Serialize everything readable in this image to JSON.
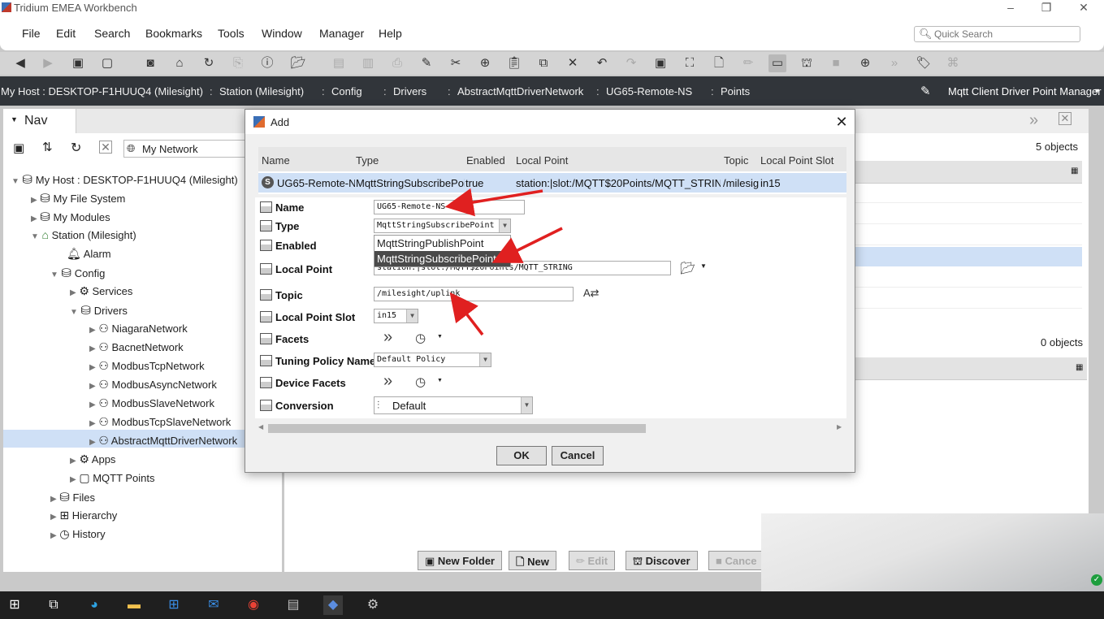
{
  "window": {
    "title": "Tridium EMEA Workbench"
  },
  "menu": [
    "File",
    "Edit",
    "Search",
    "Bookmarks",
    "Tools",
    "Window",
    "Manager",
    "Help"
  ],
  "quick_search": {
    "placeholder": "Quick Search"
  },
  "breadcrumb": [
    "My Host : DESKTOP-F1HUUQ4 (Milesight)",
    "Station (Milesight)",
    "Config",
    "Drivers",
    "AbstractMqttDriverNetwork",
    "UG65-Remote-NS",
    "Points"
  ],
  "view_selector": "Mqtt Client Driver Point Manager",
  "nav": {
    "tab_label": "Nav",
    "network_selector": "My Network",
    "tree": [
      "My Host : DESKTOP-F1HUUQ4 (Milesight)",
      "My File System",
      "My Modules",
      "Station (Milesight)",
      "Alarm",
      "Config",
      "Services",
      "Drivers",
      "NiagaraNetwork",
      "BacnetNetwork",
      "ModbusTcpNetwork",
      "ModbusAsyncNetwork",
      "ModbusSlaveNetwork",
      "ModbusTcpSlaveNetwork",
      "AbstractMqttDriverNetwork",
      "Apps",
      "MQTT Points",
      "Files",
      "Hierarchy",
      "History"
    ]
  },
  "main": {
    "objects_top": "5 objects",
    "objects_bottom": "0 objects",
    "buttons": [
      "New Folder",
      "New",
      "Edit",
      "Discover",
      "Cance"
    ]
  },
  "dialog": {
    "title": "Add",
    "columns": [
      "Name",
      "Type",
      "Enabled",
      "Local Point",
      "Topic",
      "Local Point Slot"
    ],
    "row": {
      "name": "UG65-Remote-N",
      "type": "MqttStringSubscribePoint",
      "enabled": "true",
      "local_point": "station:|slot:/MQTT$20Points/MQTT_STRING",
      "topic": "/milesig",
      "slot": "in15"
    },
    "fields": {
      "name_label": "Name",
      "name_value": "UG65-Remote-NS",
      "type_label": "Type",
      "type_value": "MqttStringSubscribePoint",
      "type_options": [
        "MqttStringPublishPoint",
        "MqttStringSubscribePoint"
      ],
      "enabled_label": "Enabled",
      "local_point_label": "Local Point",
      "local_point_value": "station:|slot:/MQTT$20Points/MQTT_STRING",
      "topic_label": "Topic",
      "topic_value": "/milesight/uplink",
      "slot_label": "Local Point Slot",
      "slot_value": "in15",
      "facets_label": "Facets",
      "tuning_label": "Tuning Policy Name",
      "tuning_value": "Default Policy",
      "device_facets_label": "Device Facets",
      "conversion_label": "Conversion",
      "conversion_value": "Default"
    },
    "ok_label": "OK",
    "cancel_label": "Cancel"
  },
  "colors": {
    "annotation_arrow": "#e02020",
    "breadcrumb_bg": "#31353a",
    "selection": "#cfe0f6"
  }
}
